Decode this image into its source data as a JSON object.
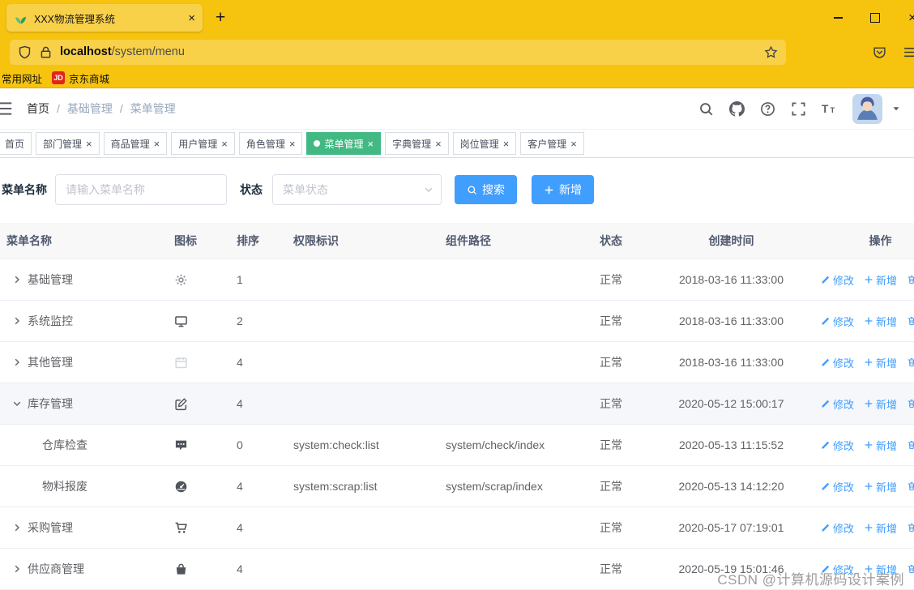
{
  "browser": {
    "tab": {
      "title": "XXX物流管理系统"
    },
    "address": {
      "host": "localhost",
      "path": "/system/menu"
    },
    "bookmarks": {
      "item1": "常用网址",
      "jd_badge": "JD",
      "item2": "京东商城"
    }
  },
  "navbar": {
    "breadcrumb": [
      {
        "label": "首页"
      },
      {
        "label": "基础管理"
      },
      {
        "label": "菜单管理"
      }
    ]
  },
  "tags": [
    {
      "label": "首页",
      "closable": false,
      "active": false
    },
    {
      "label": "部门管理",
      "closable": true,
      "active": false
    },
    {
      "label": "商品管理",
      "closable": true,
      "active": false
    },
    {
      "label": "用户管理",
      "closable": true,
      "active": false
    },
    {
      "label": "角色管理",
      "closable": true,
      "active": false
    },
    {
      "label": "菜单管理",
      "closable": true,
      "active": true
    },
    {
      "label": "字典管理",
      "closable": true,
      "active": false
    },
    {
      "label": "岗位管理",
      "closable": true,
      "active": false
    },
    {
      "label": "客户管理",
      "closable": true,
      "active": false
    }
  ],
  "filter": {
    "name_label": "菜单名称",
    "name_placeholder": "请输入菜单名称",
    "status_label": "状态",
    "status_placeholder": "菜单状态",
    "search_button": "搜索",
    "add_button": "新增"
  },
  "table": {
    "headers": [
      "菜单名称",
      "图标",
      "排序",
      "权限标识",
      "组件路径",
      "状态",
      "创建时间",
      "操作"
    ],
    "action_labels": {
      "edit": "修改",
      "add": "新增",
      "delete": "删除"
    },
    "rows": [
      {
        "name": "基础管理",
        "expand": "right",
        "level": 0,
        "icon": "gear-icon",
        "sort": "1",
        "perm": "",
        "path": "",
        "status": "正常",
        "created": "2018-03-16 11:33:00",
        "hover": false
      },
      {
        "name": "系统监控",
        "expand": "right",
        "level": 0,
        "icon": "monitor-icon",
        "sort": "2",
        "perm": "",
        "path": "",
        "status": "正常",
        "created": "2018-03-16 11:33:00",
        "hover": false
      },
      {
        "name": "其他管理",
        "expand": "right",
        "level": 0,
        "icon": "calendar-icon",
        "sort": "4",
        "perm": "",
        "path": "",
        "status": "正常",
        "created": "2018-03-16 11:33:00",
        "hover": false
      },
      {
        "name": "库存管理",
        "expand": "down",
        "level": 0,
        "icon": "edit-icon",
        "sort": "4",
        "perm": "",
        "path": "",
        "status": "正常",
        "created": "2020-05-12 15:00:17",
        "hover": true
      },
      {
        "name": "仓库检查",
        "expand": "none",
        "level": 1,
        "icon": "message-icon",
        "sort": "0",
        "perm": "system:check:list",
        "path": "system/check/index",
        "status": "正常",
        "created": "2020-05-13 11:15:52",
        "hover": false
      },
      {
        "name": "物料报废",
        "expand": "none",
        "level": 1,
        "icon": "dashboard-icon",
        "sort": "4",
        "perm": "system:scrap:list",
        "path": "system/scrap/index",
        "status": "正常",
        "created": "2020-05-13 14:12:20",
        "hover": false
      },
      {
        "name": "采购管理",
        "expand": "right",
        "level": 0,
        "icon": "cart-icon",
        "sort": "4",
        "perm": "",
        "path": "",
        "status": "正常",
        "created": "2020-05-17 07:19:01",
        "hover": false
      },
      {
        "name": "供应商管理",
        "expand": "right",
        "level": 0,
        "icon": "shop-icon",
        "sort": "4",
        "perm": "",
        "path": "",
        "status": "正常",
        "created": "2020-05-19 15:01:46",
        "hover": false
      }
    ]
  },
  "watermark": "CSDN @计算机源码设计案例",
  "colors": {
    "chrome_yellow": "#f6c30e",
    "chrome_field_yellow": "#f9d149",
    "active_tag_green": "#42b983",
    "primary_blue": "#409eff",
    "jd_red": "#e1251b"
  }
}
